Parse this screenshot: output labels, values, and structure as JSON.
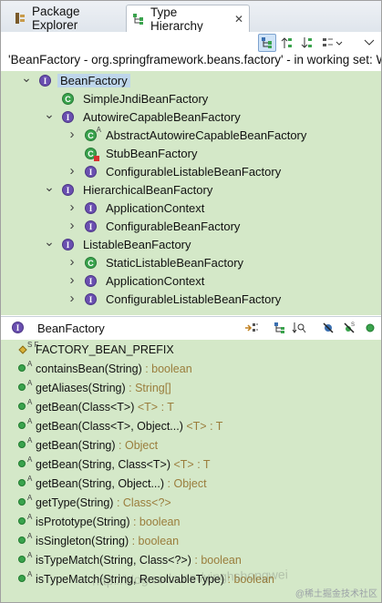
{
  "tabs": [
    {
      "label": "Package Explorer",
      "active": false
    },
    {
      "label": "Type Hierarchy",
      "active": true
    }
  ],
  "toolbar": {
    "buttons": [
      "type-hierarchy-icon",
      "supertype-hierarchy-icon",
      "subtype-hierarchy-icon",
      "history-icon",
      "view-menu-icon"
    ]
  },
  "title_line": "'BeanFactory - org.springframework.beans.factory' - in working set: W",
  "tree": [
    {
      "label": "BeanFactory",
      "kind": "interface",
      "depth": 0,
      "twisty": "expanded",
      "selected": true
    },
    {
      "label": "SimpleJndiBeanFactory",
      "kind": "class",
      "depth": 1,
      "twisty": "none"
    },
    {
      "label": "AutowireCapableBeanFactory",
      "kind": "interface",
      "depth": 1,
      "twisty": "expanded"
    },
    {
      "label": "AbstractAutowireCapableBeanFactory",
      "kind": "abstract-class",
      "depth": 2,
      "twisty": "collapsed"
    },
    {
      "label": "StubBeanFactory",
      "kind": "class-private",
      "depth": 2,
      "twisty": "none"
    },
    {
      "label": "ConfigurableListableBeanFactory",
      "kind": "interface",
      "depth": 2,
      "twisty": "collapsed"
    },
    {
      "label": "HierarchicalBeanFactory",
      "kind": "interface",
      "depth": 1,
      "twisty": "expanded"
    },
    {
      "label": "ApplicationContext",
      "kind": "interface",
      "depth": 2,
      "twisty": "collapsed"
    },
    {
      "label": "ConfigurableBeanFactory",
      "kind": "interface",
      "depth": 2,
      "twisty": "collapsed"
    },
    {
      "label": "ListableBeanFactory",
      "kind": "interface",
      "depth": 1,
      "twisty": "expanded"
    },
    {
      "label": "StaticListableBeanFactory",
      "kind": "class",
      "depth": 2,
      "twisty": "collapsed"
    },
    {
      "label": "ApplicationContext",
      "kind": "interface",
      "depth": 2,
      "twisty": "collapsed"
    },
    {
      "label": "ConfigurableListableBeanFactory",
      "kind": "interface",
      "depth": 2,
      "twisty": "collapsed"
    }
  ],
  "members_header": {
    "type_name": "BeanFactory",
    "buttons": [
      "lock-view-icon",
      "show-inherited-icon",
      "sort-by-type-icon",
      "hide-fields-icon",
      "hide-static-icon",
      "hide-non-public-icon"
    ]
  },
  "members": [
    {
      "kind": "field",
      "modifier": "S F",
      "name": "FACTORY_BEAN_PREFIX",
      "generic": "",
      "ret": ""
    },
    {
      "kind": "method",
      "modifier": "A",
      "name": "containsBean(String)",
      "generic": "",
      "ret": " : boolean"
    },
    {
      "kind": "method",
      "modifier": "A",
      "name": "getAliases(String)",
      "generic": "",
      "ret": " : String[]"
    },
    {
      "kind": "method",
      "modifier": "A",
      "name": "getBean(Class<T>)",
      "generic": " <T>",
      "ret": " : T"
    },
    {
      "kind": "method",
      "modifier": "A",
      "name": "getBean(Class<T>, Object...)",
      "generic": " <T>",
      "ret": " : T"
    },
    {
      "kind": "method",
      "modifier": "A",
      "name": "getBean(String)",
      "generic": "",
      "ret": " : Object"
    },
    {
      "kind": "method",
      "modifier": "A",
      "name": "getBean(String, Class<T>)",
      "generic": " <T>",
      "ret": " : T"
    },
    {
      "kind": "method",
      "modifier": "A",
      "name": "getBean(String, Object...)",
      "generic": "",
      "ret": " : Object"
    },
    {
      "kind": "method",
      "modifier": "A",
      "name": "getType(String)",
      "generic": "",
      "ret": " : Class<?>"
    },
    {
      "kind": "method",
      "modifier": "A",
      "name": "isPrototype(String)",
      "generic": "",
      "ret": " : boolean"
    },
    {
      "kind": "method",
      "modifier": "A",
      "name": "isSingleton(String)",
      "generic": "",
      "ret": " : boolean"
    },
    {
      "kind": "method",
      "modifier": "A",
      "name": "isTypeMatch(String, Class<?>)",
      "generic": "",
      "ret": " : boolean"
    },
    {
      "kind": "method",
      "modifier": "A",
      "name": "isTypeMatch(String, ResolvableType)",
      "generic": "",
      "ret": " : boolean"
    }
  ],
  "watermark": "http://blog.csdn.net/yinghshongwei",
  "corner_mark": "@稀土掘金技术社区",
  "colors": {
    "tree_bg": "#d4e8c8",
    "selection": "#bed6eb",
    "interface_icon": "#6a4fb0",
    "class_icon": "#3aa34d",
    "return_type": "#9a7d3c"
  }
}
